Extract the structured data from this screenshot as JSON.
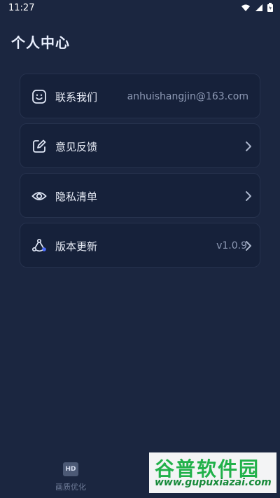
{
  "status_bar": {
    "time": "11:27",
    "icons": [
      "wifi-icon",
      "signal-icon",
      "battery-icon"
    ]
  },
  "page": {
    "title": "个人中心"
  },
  "menu": [
    {
      "id": "contact",
      "label": "联系我们",
      "value": "anhuishangjin@163.com",
      "icon": "smiley-icon",
      "has_chevron": false
    },
    {
      "id": "feedback",
      "label": "意见反馈",
      "value": "",
      "icon": "edit-icon",
      "has_chevron": true
    },
    {
      "id": "privacy",
      "label": "隐私清单",
      "value": "",
      "icon": "eye-icon",
      "has_chevron": true
    },
    {
      "id": "update",
      "label": "版本更新",
      "value": "v1.0.9",
      "icon": "network-icon",
      "has_chevron": true
    }
  ],
  "bottom_nav": {
    "tabs": [
      {
        "label": "画质优化",
        "icon_text": "HD"
      }
    ]
  },
  "watermark": {
    "brand": "谷普软件园",
    "url": "www.gupuxiazai.com"
  },
  "colors": {
    "background": "#1b2640",
    "card": "#16213a",
    "text": "#e9edf7",
    "muted": "#8e9ab5",
    "accent": "#21b14a"
  }
}
